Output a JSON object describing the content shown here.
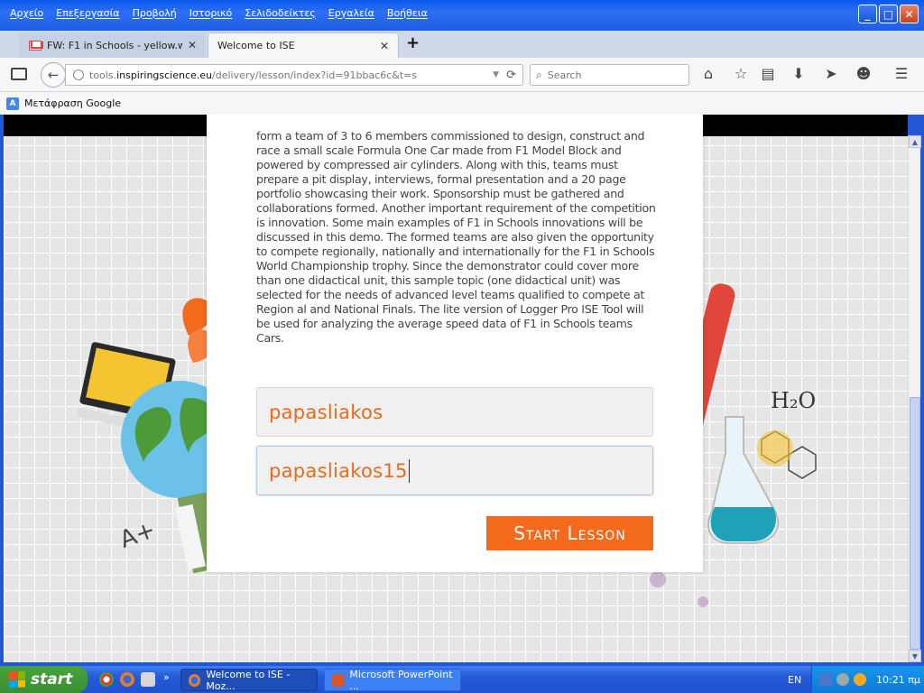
{
  "menu": [
    "Αρχείο",
    "Επεξεργασία",
    "Προβολή",
    "Ιστορικό",
    "Σελιδοδείκτες",
    "Εργαλεία",
    "Βοήθεια"
  ],
  "tabs": [
    {
      "label": "FW: F1 in Schools - yellow.wa...",
      "active": false
    },
    {
      "label": "Welcome to ISE",
      "active": true
    }
  ],
  "address": {
    "prefix": "tools.",
    "domain": "inspiringscience.eu",
    "path": "/delivery/lesson/index?id=91bbac6c&t=s"
  },
  "search": {
    "placeholder": "Search"
  },
  "bookmarks": [
    {
      "label": "Μετάφραση Google"
    }
  ],
  "lesson": {
    "description": "form a team of 3 to 6 members commissioned to design, construct and race a small scale Formula One Car made from F1 Model Block and powered by compressed air cylinders. Along with this, teams must prepare a pit display, interviews, formal presentation and a 20 page portfolio showcasing their work. Sponsorship must be gathered and collaborations formed. Another important requirement of the competition is innovation. Some main examples of F1 in Schools innovations will be discussed in this demo. The formed teams are also given the opportunity to compete regionally, nationally and internationally for the F1 in Schools World Championship trophy. Since the demonstrator could cover more than one didactical unit, this sample topic (one didactical unit) was selected for the needs of advanced level teams qualified to compete at Region al and National Finals. The lite version of Logger Pro ISE Tool will be used for analyzing the average speed data of F1 in Schools teams Cars.",
    "username": "papasliakos",
    "password": "papasliakos15",
    "start_label": "Start Lesson"
  },
  "decor": {
    "h2o": "H₂O",
    "grade": "A+"
  },
  "taskbar": {
    "start_label": "start",
    "tasks": [
      {
        "label": "Welcome to ISE - Moz..."
      },
      {
        "label": "Microsoft PowerPoint ..."
      }
    ],
    "language": "EN",
    "time": "10:21 πμ"
  },
  "colors": {
    "accent": "#f36a1d",
    "input_text": "#e86a1a"
  }
}
